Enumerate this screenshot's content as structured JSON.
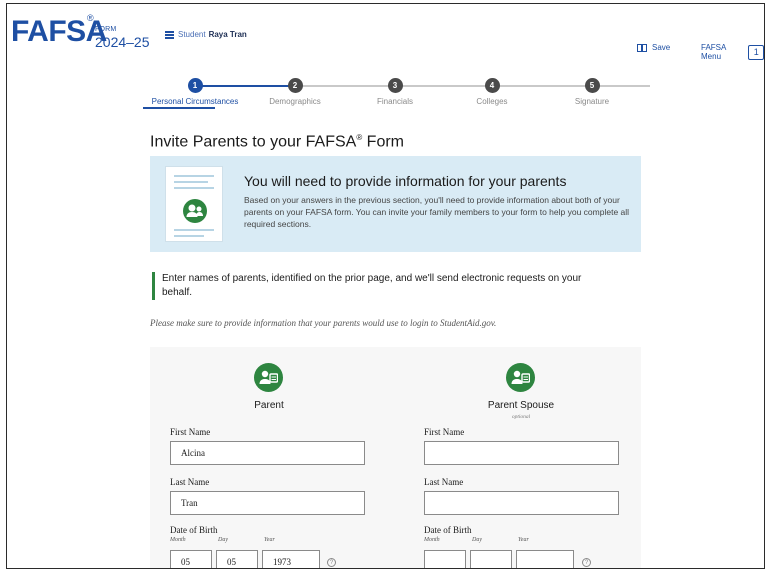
{
  "header": {
    "logo": "FAFSA",
    "logo_reg": "®",
    "form_label": "FORM",
    "form_year": "2024–25",
    "student_label": "Student",
    "student_name": "Raya Tran",
    "save_label": "Save",
    "menu_label": "FAFSA Menu"
  },
  "stepper": {
    "steps": [
      {
        "number": "1",
        "label": "Personal Circumstances"
      },
      {
        "number": "2",
        "label": "Demographics"
      },
      {
        "number": "3",
        "label": "Financials"
      },
      {
        "number": "4",
        "label": "Colleges"
      },
      {
        "number": "5",
        "label": "Signature"
      }
    ],
    "current_step": 1
  },
  "page": {
    "title": "Invite Parents to your FAFSA",
    "title_sup": "®",
    "title_end": " Form"
  },
  "banner": {
    "heading": "You will need to provide information for your parents",
    "body": "Based on your answers in the previous section, you'll need to provide information about both of your parents on your FAFSA form. You can invite your family members to your form to help you complete all required sections."
  },
  "instruction": "Enter names of parents, identified on the prior page, and we'll send electronic requests on your behalf.",
  "note": "Please make sure to provide information that your parents would use to login to StudentAid.gov.",
  "parent": {
    "title": "Parent",
    "first_name_label": "First Name",
    "first_name_value": "Alcina",
    "last_name_label": "Last Name",
    "last_name_value": "Tran",
    "dob_label": "Date of Birth",
    "month_label": "Month",
    "day_label": "Day",
    "year_label": "Year",
    "month_value": "05",
    "day_value": "05",
    "year_value": "1973"
  },
  "spouse": {
    "title": "Parent Spouse",
    "subtitle": "optional",
    "first_name_label": "First Name",
    "first_name_value": "",
    "last_name_label": "Last Name",
    "last_name_value": "",
    "dob_label": "Date of Birth",
    "month_label": "Month",
    "day_label": "Day",
    "year_label": "Year",
    "month_value": "",
    "day_value": "",
    "year_value": ""
  },
  "help_glyph": "?",
  "menu_glyph": "1",
  "colors": {
    "brand_blue": "#1e4fa3",
    "banner_bg": "#d9ebf5",
    "accent_green": "#2e8540"
  }
}
